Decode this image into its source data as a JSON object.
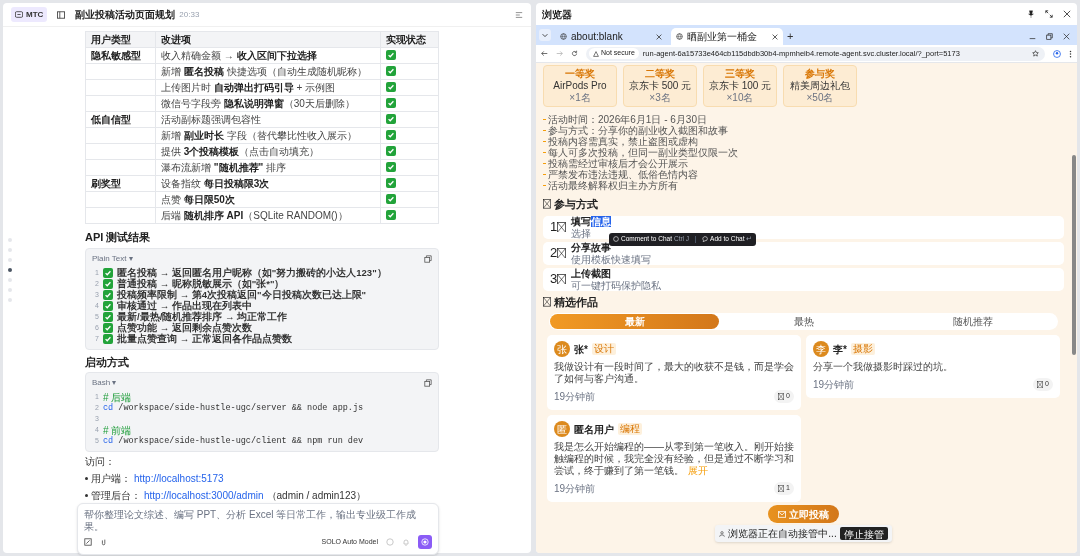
{
  "chat": {
    "badge": "MTC",
    "title": "副业投稿活动页面规划",
    "time": "20:33",
    "nav_dots": [
      {
        "selected": false
      },
      {
        "selected": false
      },
      {
        "selected": false
      },
      {
        "selected": true
      },
      {
        "selected": false
      },
      {
        "selected": false
      },
      {
        "selected": false
      }
    ],
    "table": {
      "columns": [
        "用户类型",
        "改进项",
        "实现状态"
      ],
      "rows": [
        {
          "user_type": "隐私敏感型",
          "item": "收入精确金额 → **收入区间下拉选择**",
          "done": true
        },
        {
          "item": "新增 **匿名投稿** 快捷选项（自动生成随机昵称）",
          "done": true
        },
        {
          "item": "上传图片时 **自动弹出打码引导** + 示例图",
          "done": true
        },
        {
          "item": "微信号字段旁 **隐私说明弹窗**（30天后删除）",
          "done": true
        },
        {
          "user_type": "低自信型",
          "item": "活动副标题强调包容性",
          "done": true
        },
        {
          "item": "新增 **副业时长** 字段（替代攀比性收入展示）",
          "done": true
        },
        {
          "item": "提供 **3个投稿模板**（点击自动填充）",
          "done": true
        },
        {
          "item": "瀑布流新增 **\"随机推荐\"** 排序",
          "done": true
        },
        {
          "user_type": "刷奖型",
          "item": "设备指纹 **每日投稿限3次**",
          "done": true
        },
        {
          "item": "点赞 **每日限50次**",
          "done": true
        },
        {
          "item": "后端 **随机排序 API**（SQLite RANDOM()）",
          "done": true
        }
      ]
    },
    "api_heading": "API 测试结果",
    "api_block": {
      "language": "Plain Text",
      "caret": "▾",
      "lines": [
        {
          "number": "1",
          "done": true,
          "text": "匿名投稿 → 返回匿名用户昵称（如\"努力搬砖的小达人123\"）"
        },
        {
          "number": "2",
          "done": true,
          "text": "普通投稿 → 昵称脱敏展示（如\"张*\"）"
        },
        {
          "number": "3",
          "done": true,
          "text": "投稿频率限制 → 第4次投稿返回\"今日投稿次数已达上限\""
        },
        {
          "number": "4",
          "done": true,
          "text": "审核通过 → 作品出现在列表中"
        },
        {
          "number": "5",
          "done": true,
          "text": "最新/最热/随机推荐排序 → 均正常工作"
        },
        {
          "number": "6",
          "done": true,
          "text": "点赞功能 → 返回剩余点赞次数"
        },
        {
          "number": "7",
          "done": true,
          "text": "批量点赞查询 → 正常返回各作品点赞数"
        }
      ]
    },
    "start_heading": "启动方式",
    "bash_block": {
      "language": "Bash",
      "caret": "▾",
      "lines": [
        {
          "number": "1",
          "kind": "comment",
          "text": "# 后端"
        },
        {
          "number": "2",
          "kind": "command",
          "keyword": "cd",
          "text": "/workspace/side-hustle-ugc/server && node app.js"
        },
        {
          "number": "3",
          "kind": "blank"
        },
        {
          "number": "4",
          "kind": "comment",
          "text": "# 前端"
        },
        {
          "number": "5",
          "kind": "command",
          "keyword": "cd",
          "text": "/workspace/side-hustle-ugc/client && npm run dev"
        }
      ]
    },
    "access_label": "访问：",
    "links": [
      {
        "label": "用户端：",
        "url": "http://localhost:5173"
      },
      {
        "label": "管理后台：",
        "url": "http://localhost:3000/admin",
        "note": "（admin / admin123）"
      }
    ],
    "input": {
      "placeholder": "帮你整理论文综述、编写 PPT、分析 Excel 等日常工作，输出专业级工作成果。",
      "model": "SOLO Auto Model"
    }
  },
  "browser": {
    "title": "浏览器",
    "tabs": [
      {
        "label": "about:blank",
        "selected": false
      },
      {
        "label": "晒副业第一桶金",
        "selected": true
      }
    ],
    "new_tab": "+",
    "security": "Not secure",
    "url": "run-agent-6a15733e464cb115dbdb30b4-mpmheib4.remote-agent.svc.cluster.local/?_port=5173",
    "page": {
      "prizes": [
        {
          "rank": "一等奖",
          "name": "AirPods Pro",
          "count": "×1名"
        },
        {
          "rank": "二等奖",
          "name": "京东卡 500 元",
          "count": "×3名"
        },
        {
          "rank": "三等奖",
          "name": "京东卡 100 元",
          "count": "×10名"
        },
        {
          "rank": "参与奖",
          "name": "精美周边礼包",
          "count": "×50名"
        }
      ],
      "rules": [
        "活动时间：2026年6月1日 - 6月30日",
        "参与方式：分享你的副业收入截图和故事",
        "投稿内容需真实，禁止盗图或虚构",
        "每人可多次投稿，但同一副业类型仅限一次",
        "投稿需经过审核后才会公开展示",
        "严禁发布违法违规、低俗色情内容",
        "活动最终解释权归主办方所有"
      ],
      "steps_heading": "参与方式",
      "steps": [
        {
          "number": "1",
          "title_parts": [
            {
              "text": "填写",
              "highlighted": false
            },
            {
              "text": "信息",
              "highlighted": true
            }
          ],
          "desc": "选择"
        },
        {
          "number": "2",
          "title_parts": [
            {
              "text": "分享故事",
              "highlighted": false
            }
          ],
          "desc": "使用模板快速填写"
        },
        {
          "number": "3",
          "title_parts": [
            {
              "text": "上传截图",
              "highlighted": false
            }
          ],
          "desc": "可一键打码保护隐私"
        }
      ],
      "selection_menu": {
        "comment": "Comment to Chat",
        "shortcut": "Ctrl J",
        "add": "Add to Chat",
        "enter": "↵"
      },
      "works_heading": "精选作品",
      "sort_tabs": [
        {
          "label": "最新",
          "selected": true
        },
        {
          "label": "最热",
          "selected": false
        },
        {
          "label": "随机推荐",
          "selected": false
        }
      ],
      "works": [
        {
          "avatar": "张",
          "name": "张*",
          "tag": "设计",
          "text": "我做设计有一段时间了，最大的收获不是钱，而是学会了如何与客户沟通。",
          "time": "19分钟前",
          "likes": "0"
        },
        {
          "avatar": "李",
          "name": "李*",
          "tag": "摄影",
          "text": "分享一个我做摄影时踩过的坑。",
          "time": "19分钟前",
          "likes": "0"
        },
        {
          "avatar": "匿",
          "name": "匿名用户",
          "tag": "编程",
          "text": "我是怎么开始编程的——从零到第一笔收入。刚开始接触编程的时候，我完全没有经验，但是通过不断学习和尝试，终于赚到了第一笔钱。",
          "more": "展开",
          "time": "19分钟前",
          "likes": "1"
        }
      ],
      "submit": "立即投稿"
    },
    "takeover": {
      "text": "浏览器正在自动接管中...",
      "stop": "停止接管"
    }
  }
}
